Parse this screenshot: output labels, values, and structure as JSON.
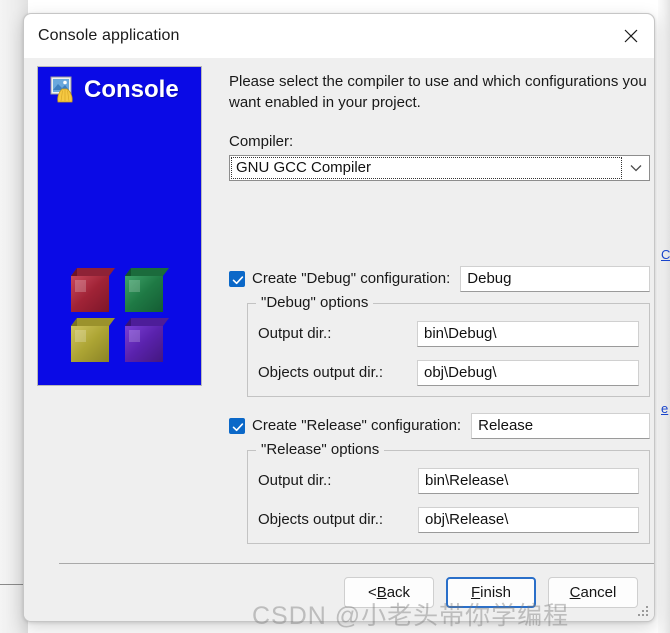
{
  "window": {
    "title": "Console application",
    "close_icon": "close-icon"
  },
  "branding": {
    "title": "Console",
    "icon": "console-image-icon",
    "logo": "codeblocks-cubes-logo",
    "background_color": "#0a0ae6",
    "cube_colors": [
      "#b02a3f",
      "#2a8a4f",
      "#b3a93c",
      "#6a2fc0"
    ]
  },
  "main": {
    "instructions": "Please select the compiler to use and which configurations you want enabled in your project.",
    "compiler": {
      "label": "Compiler:",
      "value": "GNU GCC Compiler",
      "arrow_icon": "chevron-down-icon"
    },
    "debug": {
      "checkbox_label": "Create \"Debug\" configuration:",
      "checked": true,
      "name_value": "Debug",
      "group_legend": "\"Debug\" options",
      "output_dir_label": "Output dir.:",
      "output_dir_value": "bin\\Debug\\",
      "objects_dir_label": "Objects output dir.:",
      "objects_dir_value": "obj\\Debug\\"
    },
    "release": {
      "checkbox_label": "Create \"Release\" configuration:",
      "checked": true,
      "name_value": "Release",
      "group_legend": "\"Release\" options",
      "output_dir_label": "Output dir.:",
      "output_dir_value": "bin\\Release\\",
      "objects_dir_label": "Objects output dir.:",
      "objects_dir_value": "obj\\Release\\"
    }
  },
  "footer": {
    "back_label": "< Back",
    "back_prefix": "< ",
    "back_accesskey": "B",
    "back_suffix": "ack",
    "finish_prefix": "",
    "finish_accesskey": "F",
    "finish_suffix": "inish",
    "cancel_prefix": "",
    "cancel_accesskey": "C",
    "cancel_suffix": "ancel"
  },
  "overlay": {
    "watermark": "CSDN @小老头带你学编程"
  },
  "background": {
    "link_fragment_1": "C",
    "link_fragment_2": "e",
    "link_color": "#1a46d0"
  },
  "colors": {
    "accent": "#0b68c8",
    "focus_ring": "#2a6fc9",
    "dialog_bg": "#efefef",
    "titlebar_bg": "#ffffff"
  }
}
